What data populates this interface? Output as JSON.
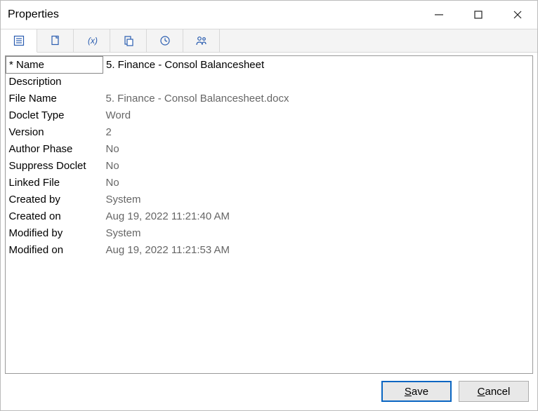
{
  "window": {
    "title": "Properties"
  },
  "tabs": {
    "t0": "properties-list-icon",
    "t1": "copy-sheet-icon",
    "t2": "variable-x-icon",
    "t3": "paste-icon",
    "t4": "clock-icon",
    "t5": "users-icon"
  },
  "rows": [
    {
      "label": "* Name",
      "value": "5. Finance - Consol Balancesheet",
      "editable": true
    },
    {
      "label": "Description",
      "value": ""
    },
    {
      "label": "File Name",
      "value": "5. Finance - Consol Balancesheet.docx"
    },
    {
      "label": "Doclet Type",
      "value": "Word"
    },
    {
      "label": "Version",
      "value": "2"
    },
    {
      "label": "Author Phase",
      "value": "No"
    },
    {
      "label": "Suppress Doclet",
      "value": "No"
    },
    {
      "label": "Linked File",
      "value": "No"
    },
    {
      "label": "Created by",
      "value": "System"
    },
    {
      "label": "Created on",
      "value": "Aug 19, 2022 11:21:40 AM"
    },
    {
      "label": "Modified by",
      "value": "System"
    },
    {
      "label": "Modified on",
      "value": "Aug 19, 2022 11:21:53 AM"
    }
  ],
  "buttons": {
    "save": "Save",
    "cancel": "Cancel"
  }
}
